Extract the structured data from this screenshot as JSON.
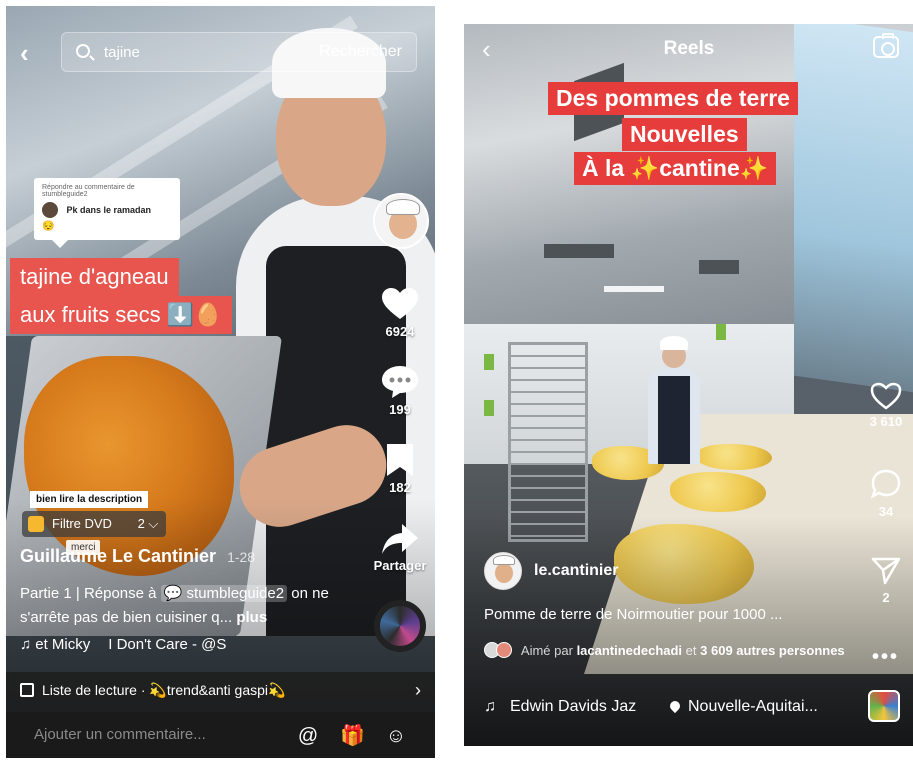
{
  "tiktok": {
    "search": {
      "query": "tajine",
      "button": "Rechercher"
    },
    "reply_card": {
      "header": "Répondre au commentaire de stumbleguide2",
      "comment": "Pk dans le ramadan",
      "emoji": "😔"
    },
    "captions": {
      "line1": "tajine d'agneau",
      "line2": "aux fruits secs ⬇️🥚"
    },
    "actions": {
      "likes": "6924",
      "comments": "199",
      "saves": "182",
      "share": "Partager"
    },
    "description_sticker": "bien lire la description",
    "filter": {
      "label": "Filtre DVD",
      "count": "2 ⌵"
    },
    "sticker_merci": "merci",
    "author": {
      "name": "Guillaume Le Cantinier",
      "date": "1-28"
    },
    "text": {
      "part": "Partie 1",
      "reply_prefix": "Réponse à",
      "mention": "stumbleguide2",
      "tail": "on ne s'arrête pas de bien cuisiner q...",
      "more": "plus"
    },
    "music": {
      "artists": "et Micky",
      "song": "I Don't Care - @S"
    },
    "playlist": "Liste de lecture · 💫trend&anti gaspi💫",
    "comment_placeholder": "Ajouter un commentaire...",
    "icons": {
      "mention": "@",
      "gift": "🎁",
      "emoji": "☺"
    }
  },
  "reels": {
    "header_title": "Reels",
    "captions": {
      "line1": "Des pommes de terre",
      "line2": "Nouvelles",
      "line3": "À la ✨cantine✨"
    },
    "actions": {
      "likes": "3 610",
      "comments": "34",
      "shares": "2"
    },
    "username": "le.cantinier",
    "description": "Pomme de terre de Noirmoutier pour 1000 ...",
    "liked_by": {
      "prefix": "Aimé par",
      "user": "lacantinedechadi",
      "middle": "et",
      "count": "3 609 autres personnes"
    },
    "audio": "Edwin Davids Jaz",
    "location": "Nouvelle-Aquitai...",
    "more": "•••"
  },
  "colors": {
    "caption_red": "#e8554f",
    "reels_caption_red": "#e63c3c",
    "comment_bar": "#1a1a1a"
  }
}
